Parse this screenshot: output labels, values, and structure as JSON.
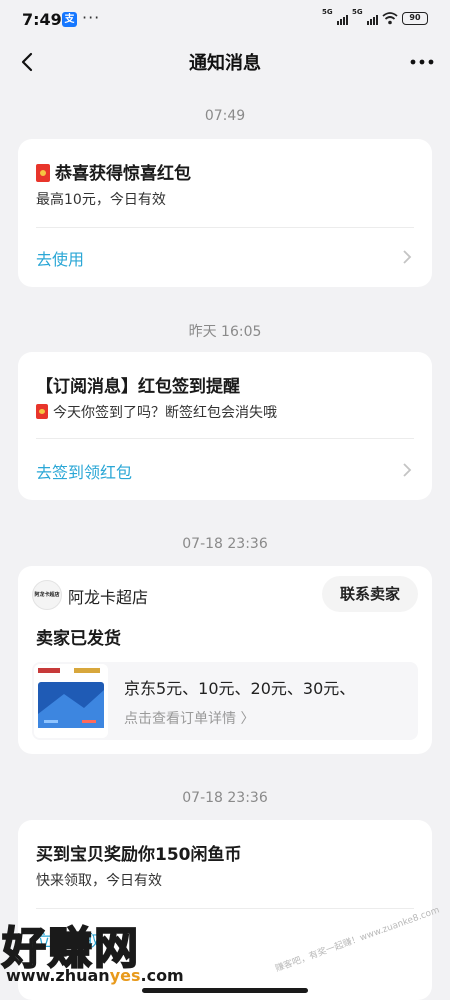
{
  "status_bar": {
    "time": "7:49",
    "app_icon": "支",
    "dots": "···",
    "signal_1": "5G",
    "signal_2": "5G",
    "battery": "90"
  },
  "header": {
    "title": "通知消息"
  },
  "messages": [
    {
      "time": "07:49",
      "title": "恭喜获得惊喜红包",
      "subtitle": "最高10元，今日有效",
      "action": "去使用"
    },
    {
      "time": "昨天 16:05",
      "title": "【订阅消息】红包签到提醒",
      "subtitle": "今天你签到了吗？断签红包会消失哦",
      "action": "去签到领红包"
    },
    {
      "time": "07-18 23:36",
      "shop_logo_text": "阿龙卡超店",
      "shop_name": "阿龙卡超店",
      "contact": "联系卖家",
      "title": "卖家已发货",
      "product_title": "京东5元、10元、20元、30元、",
      "order_link": "点击查看订单详情 〉"
    },
    {
      "time": "07-18 23:36",
      "title": "买到宝贝奖励你150闲鱼币",
      "subtitle": "快来领取，今日有效",
      "action": "立即领取"
    }
  ],
  "watermark": {
    "brand": "好赚网",
    "url_part1": "www.zhuan",
    "url_part2": "yes",
    "url_part3": ".com",
    "faint": "赚客吧，有奖一起赚！www.zuanke8.com"
  },
  "colors": {
    "background": "#f2f2f4",
    "accent": "#2ba7d6",
    "red_packet": "#e8352b"
  }
}
